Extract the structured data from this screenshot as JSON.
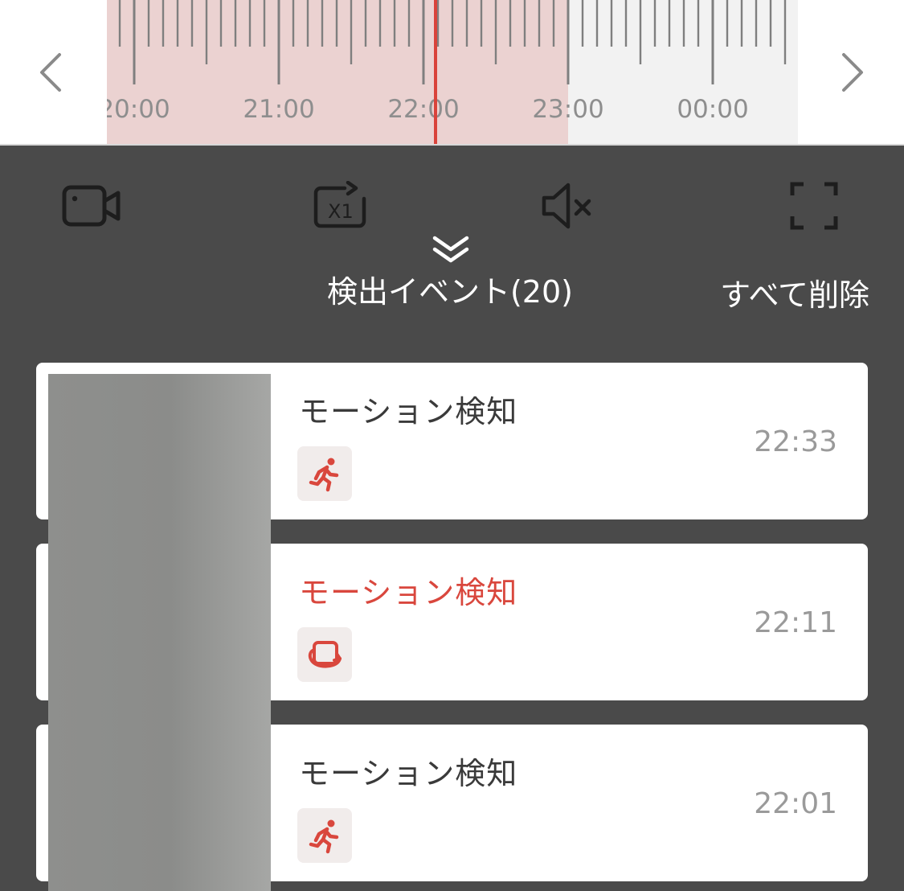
{
  "timeline": {
    "ticks": [
      "20:00",
      "21:00",
      "22:00",
      "23:00",
      "00:00"
    ],
    "recorded_until": "23:00",
    "playhead_time": "22:05",
    "recorded_color": "#ebd2d1",
    "playhead_color": "#d9433b"
  },
  "controls": {
    "icons": [
      "video-camera-icon",
      "playback-speed-x1-icon",
      "mute-icon",
      "fullscreen-icon"
    ],
    "speed_label": "X1"
  },
  "events": {
    "title": "検出イベント(20)",
    "delete_all": "すべて削除",
    "items": [
      {
        "title": "モーション検知",
        "time": "22:33",
        "icon": "running-person-icon",
        "active": false
      },
      {
        "title": "モーション検知",
        "time": "22:11",
        "icon": "rotate-device-icon",
        "active": true
      },
      {
        "title": "モーション検知",
        "time": "22:01",
        "icon": "running-person-icon",
        "active": false
      }
    ]
  },
  "colors": {
    "accent": "#d9473d",
    "panel_bg": "#4a4a4a"
  }
}
